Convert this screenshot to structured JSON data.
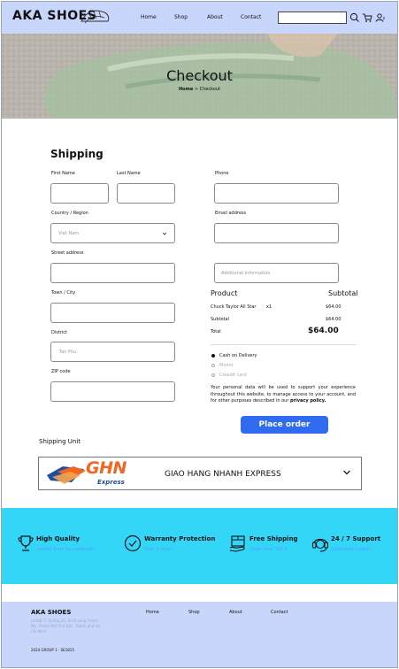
{
  "header": {
    "brand": "AKA SHOES",
    "nav": [
      "Home",
      "Shop",
      "About",
      "Contact"
    ],
    "search_placeholder": ""
  },
  "hero": {
    "title": "Checkout",
    "crumb_home": "Home",
    "crumb_sep": ">",
    "crumb_current": "Checkout"
  },
  "shipping": {
    "heading": "Shipping",
    "first_name_label": "First Name",
    "last_name_label": "Last Name",
    "phone_label": "Phone",
    "country_label": "Country / Region",
    "country_value": "Viet Nam",
    "email_label": "Email address",
    "street_label": "Street address",
    "additional_placeholder": "Additional information",
    "town_label": "Town / City",
    "district_label": "District",
    "district_placeholder": "Tan Phu",
    "zip_label": "ZIP code"
  },
  "order": {
    "product_header": "Product",
    "subtotal_header": "Subtotal",
    "item_name": "Chuck Taylor All Star",
    "item_qty": "x1",
    "item_price": "$64.00",
    "subtotal_label": "Subtotal",
    "subtotal_value": "$64.00",
    "total_label": "Total",
    "total_value": "$64.00",
    "payments": [
      "Cash on Delivery",
      "Momo",
      "Creadit card"
    ],
    "policy_text": "Your personal data will be used to support your experience throughout this website, to manage access to your account, and for other purposes described in our ",
    "policy_link": "privacy policy.",
    "place_order": "Place order"
  },
  "shipping_unit": {
    "heading": "Shipping Unit",
    "logo_text": "GHN",
    "logo_sub": "Express",
    "name": "GIAO HANG NHANH EXPRESS"
  },
  "features": [
    {
      "title": "High Quality",
      "subtitle": "crafted from top materials"
    },
    {
      "title": "Warranty Protection",
      "subtitle": "Over 2 years"
    },
    {
      "title": "Free Shipping",
      "subtitle": "Order over 150 $"
    },
    {
      "title": "24 / 7 Support",
      "subtitle": "Dedicated support"
    }
  ],
  "footer": {
    "brand": "AKA SHOES",
    "address": "Lô Đất 7, Đường D1, Bí Dĩ Long Thạnh Mỹ, Thành Phố Thủ Đức, Thành phố Hồ Chí Minh",
    "nav": [
      "Home",
      "Shop",
      "About",
      "Contact"
    ],
    "copyright": "2024 GROUP 1 - SE1815"
  },
  "colors": {
    "header_bg": "#c9d6fb",
    "features_bg": "#34d6f8",
    "button": "#2e6bf0",
    "ghn_orange": "#f26522",
    "ghn_blue": "#1e4f9c"
  }
}
